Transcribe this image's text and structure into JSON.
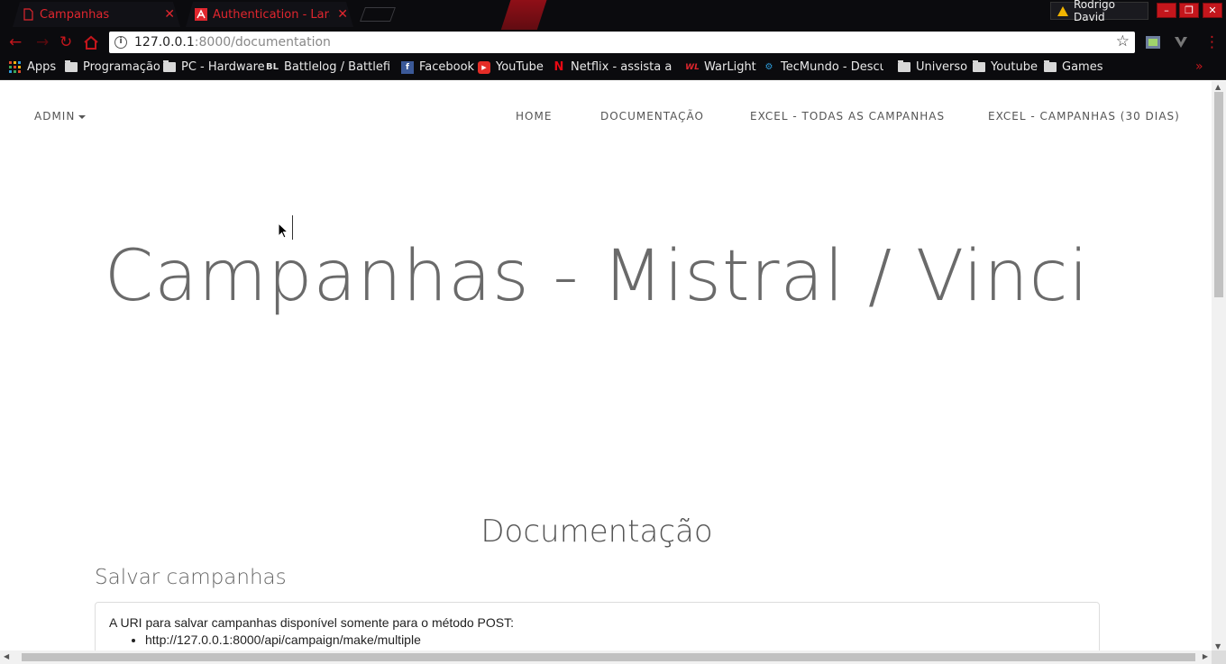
{
  "browser": {
    "tabs": [
      {
        "title": "Campanhas",
        "close": "✕"
      },
      {
        "title": "Authentication - Laravel",
        "close": "✕"
      }
    ],
    "profile_name": "Rodrigo David",
    "window_buttons": {
      "minimize": "–",
      "restore": "❐",
      "close": "✕"
    },
    "url_host": "127.0.0.1",
    "url_path": ":8000/documentation",
    "bookmarks": [
      {
        "label": "Apps",
        "icon": "apps-grid-icon"
      },
      {
        "label": "Programação",
        "icon": "folder-icon"
      },
      {
        "label": "PC - Hardware",
        "icon": "folder-icon"
      },
      {
        "label": "Battlelog / Battlefield",
        "icon": "battlelog-icon"
      },
      {
        "label": "Facebook",
        "icon": "facebook-icon"
      },
      {
        "label": "YouTube",
        "icon": "youtube-icon"
      },
      {
        "label": "Netflix - assista a séries",
        "icon": "netflix-icon"
      },
      {
        "label": "WarLight",
        "icon": "warlight-icon"
      },
      {
        "label": "TecMundo - Descubra",
        "icon": "tecmundo-icon"
      },
      {
        "label": "Universo",
        "icon": "folder-icon"
      },
      {
        "label": "Youtube",
        "icon": "folder-icon"
      },
      {
        "label": "Games",
        "icon": "folder-icon"
      }
    ],
    "more": "»"
  },
  "site": {
    "admin_label": "ADMIN",
    "nav_links": [
      "HOME",
      "DOCUMENTAÇÃO",
      "EXCEL - TODAS AS CAMPANHAS",
      "EXCEL - CAMPANHAS (30 DIAS)"
    ],
    "hero_title": "Campanhas - Mistral / Vinci",
    "doc_title": "Documentação",
    "section_title": "Salvar campanhas",
    "panel_text": "A URI para salvar campanhas disponível somente para o método POST:",
    "panel_items": [
      "http://127.0.0.1:8000/api/campaign/make/multiple"
    ]
  },
  "colors": {
    "accent_red": "#c4161c",
    "tab_text": "#e0262e",
    "chrome_bg": "#0b0b0e"
  }
}
